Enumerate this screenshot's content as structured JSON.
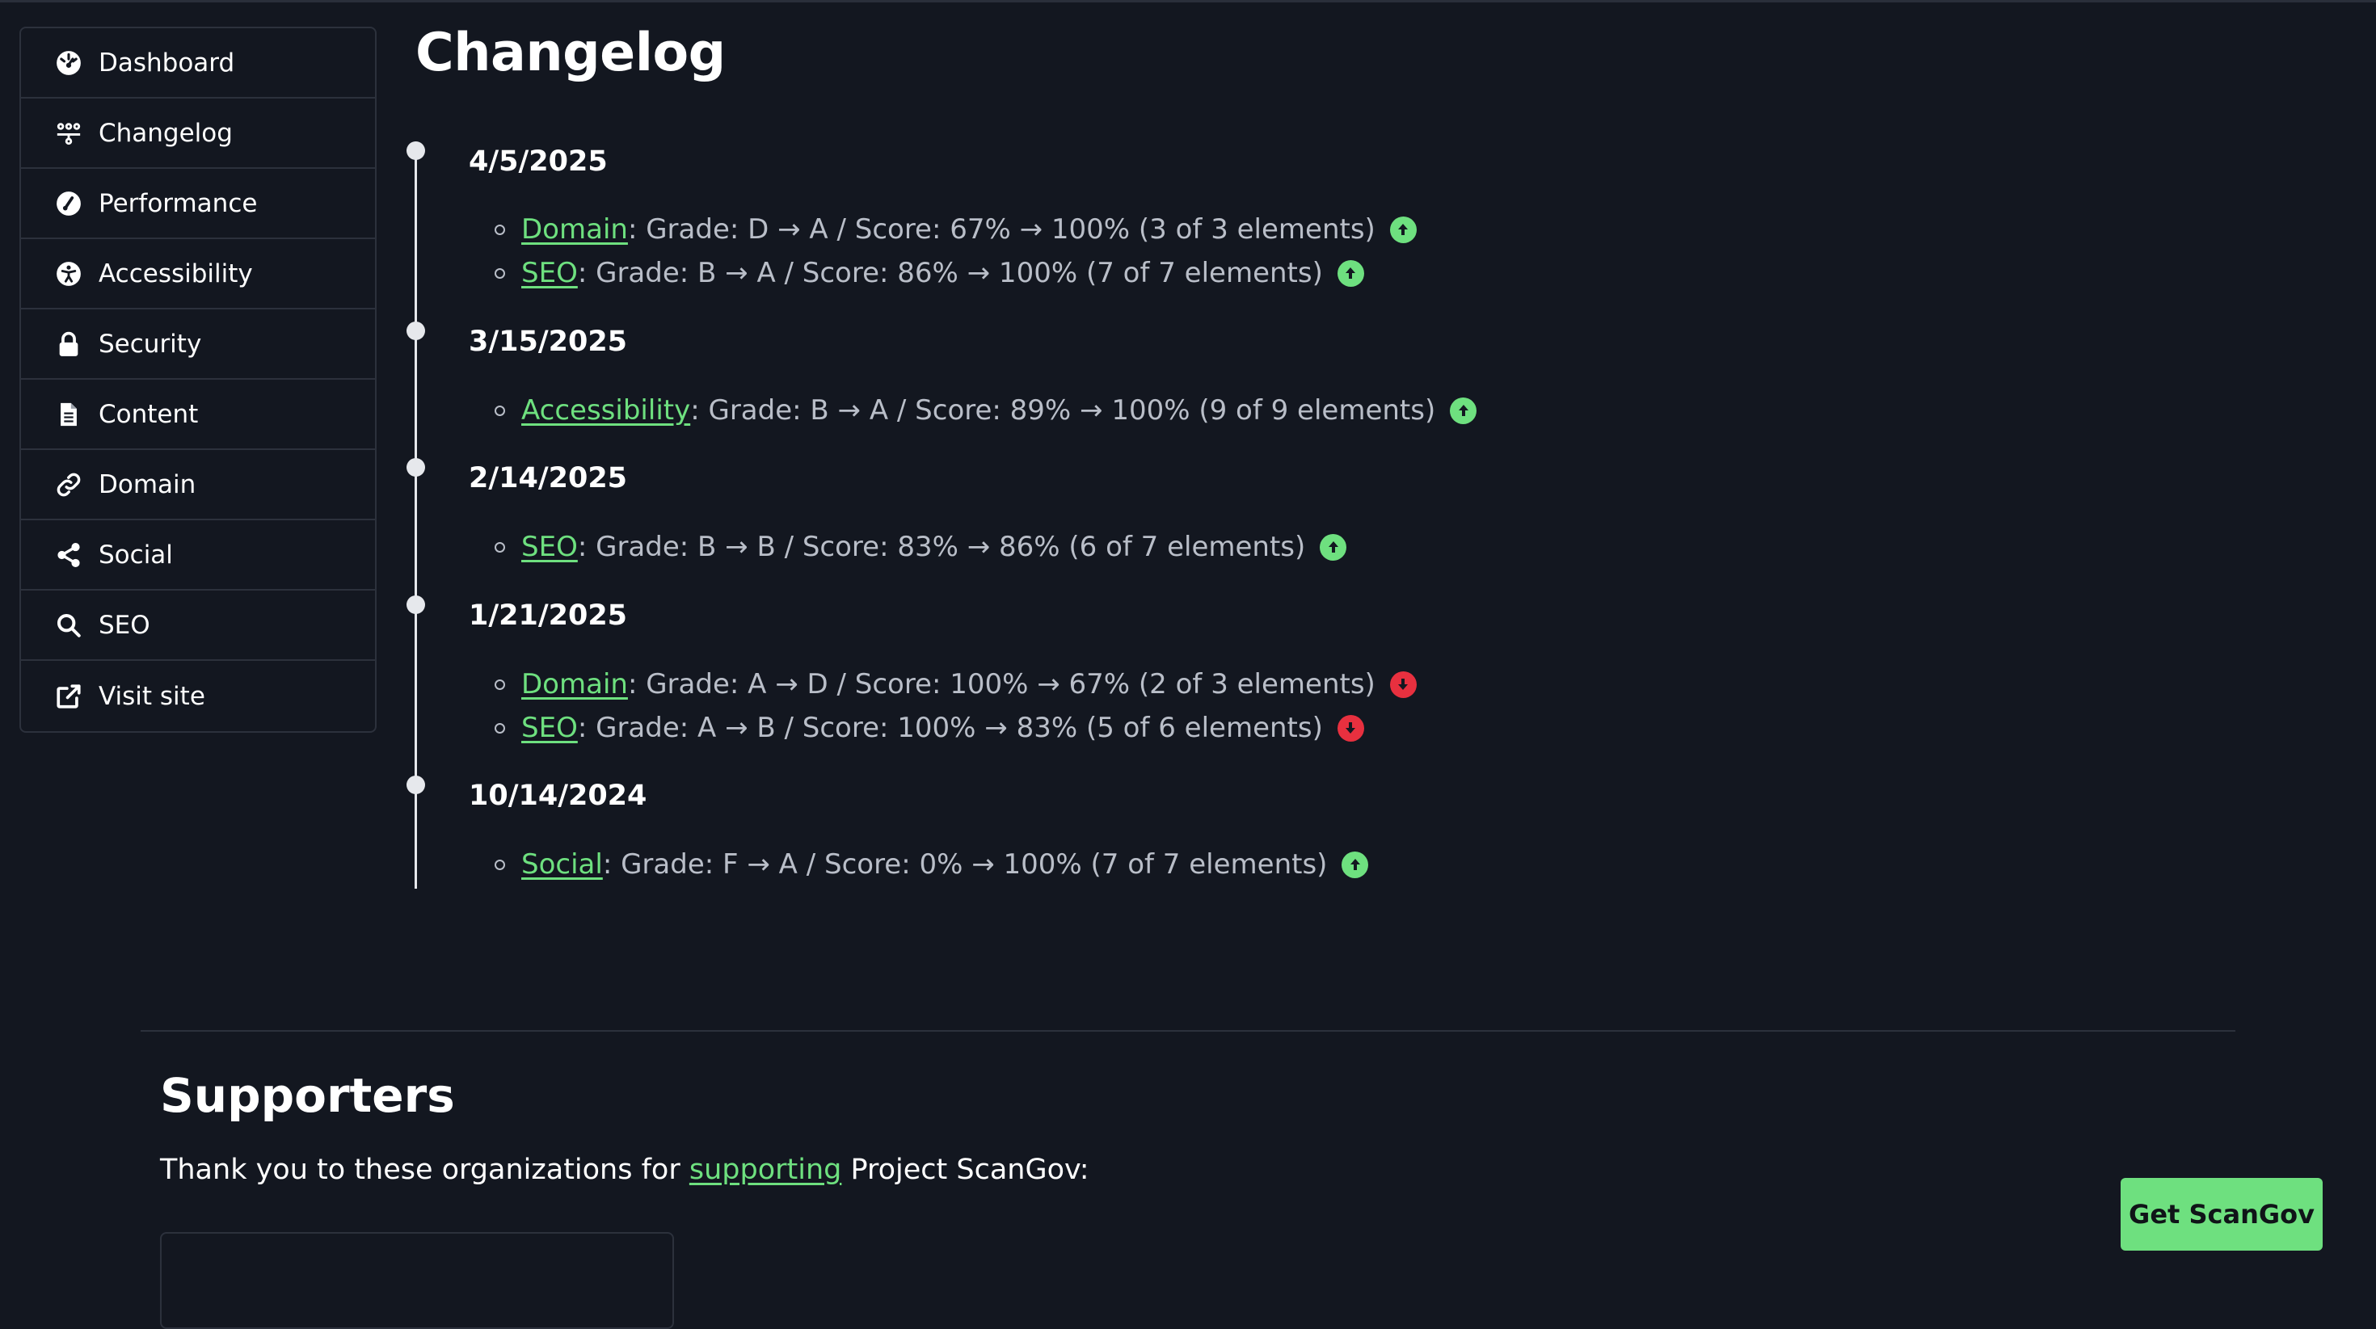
{
  "sidebar": {
    "items": [
      {
        "label": "Dashboard",
        "icon": "gauge-icon"
      },
      {
        "label": "Changelog",
        "icon": "changelog-icon"
      },
      {
        "label": "Performance",
        "icon": "performance-icon"
      },
      {
        "label": "Accessibility",
        "icon": "accessibility-icon"
      },
      {
        "label": "Security",
        "icon": "lock-icon"
      },
      {
        "label": "Content",
        "icon": "document-icon"
      },
      {
        "label": "Domain",
        "icon": "link-icon"
      },
      {
        "label": "Social",
        "icon": "share-icon"
      },
      {
        "label": "SEO",
        "icon": "search-icon"
      },
      {
        "label": "Visit site",
        "icon": "external-link-icon"
      }
    ]
  },
  "main": {
    "title": "Changelog",
    "timeline": [
      {
        "date": "4/5/2025",
        "entries": [
          {
            "link": "Domain",
            "text": ": Grade: D → A / Score: 67% → 100% (3 of 3 elements)",
            "trend": "up"
          },
          {
            "link": "SEO",
            "text": ": Grade: B → A / Score: 86% → 100% (7 of 7 elements)",
            "trend": "up"
          }
        ]
      },
      {
        "date": "3/15/2025",
        "entries": [
          {
            "link": "Accessibility",
            "text": ": Grade: B → A / Score: 89% → 100% (9 of 9 elements)",
            "trend": "up"
          }
        ]
      },
      {
        "date": "2/14/2025",
        "entries": [
          {
            "link": "SEO",
            "text": ": Grade: B → B / Score: 83% → 86% (6 of 7 elements)",
            "trend": "up"
          }
        ]
      },
      {
        "date": "1/21/2025",
        "entries": [
          {
            "link": "Domain",
            "text": ": Grade: A → D / Score: 100% → 67% (2 of 3 elements)",
            "trend": "down"
          },
          {
            "link": "SEO",
            "text": ": Grade: A → B / Score: 100% → 83% (5 of 6 elements)",
            "trend": "down"
          }
        ]
      },
      {
        "date": "10/14/2024",
        "entries": [
          {
            "link": "Social",
            "text": ": Grade: F → A / Score: 0% → 100% (7 of 7 elements)",
            "trend": "up"
          }
        ]
      }
    ]
  },
  "supporters": {
    "title": "Supporters",
    "text_before": "Thank you to these organizations for ",
    "link": "supporting",
    "text_after": " Project ScanGov:"
  },
  "cta": {
    "label": "Get ScanGov"
  },
  "colors": {
    "accent": "#6ee07f",
    "down": "#e8303f",
    "background": "#131720"
  }
}
